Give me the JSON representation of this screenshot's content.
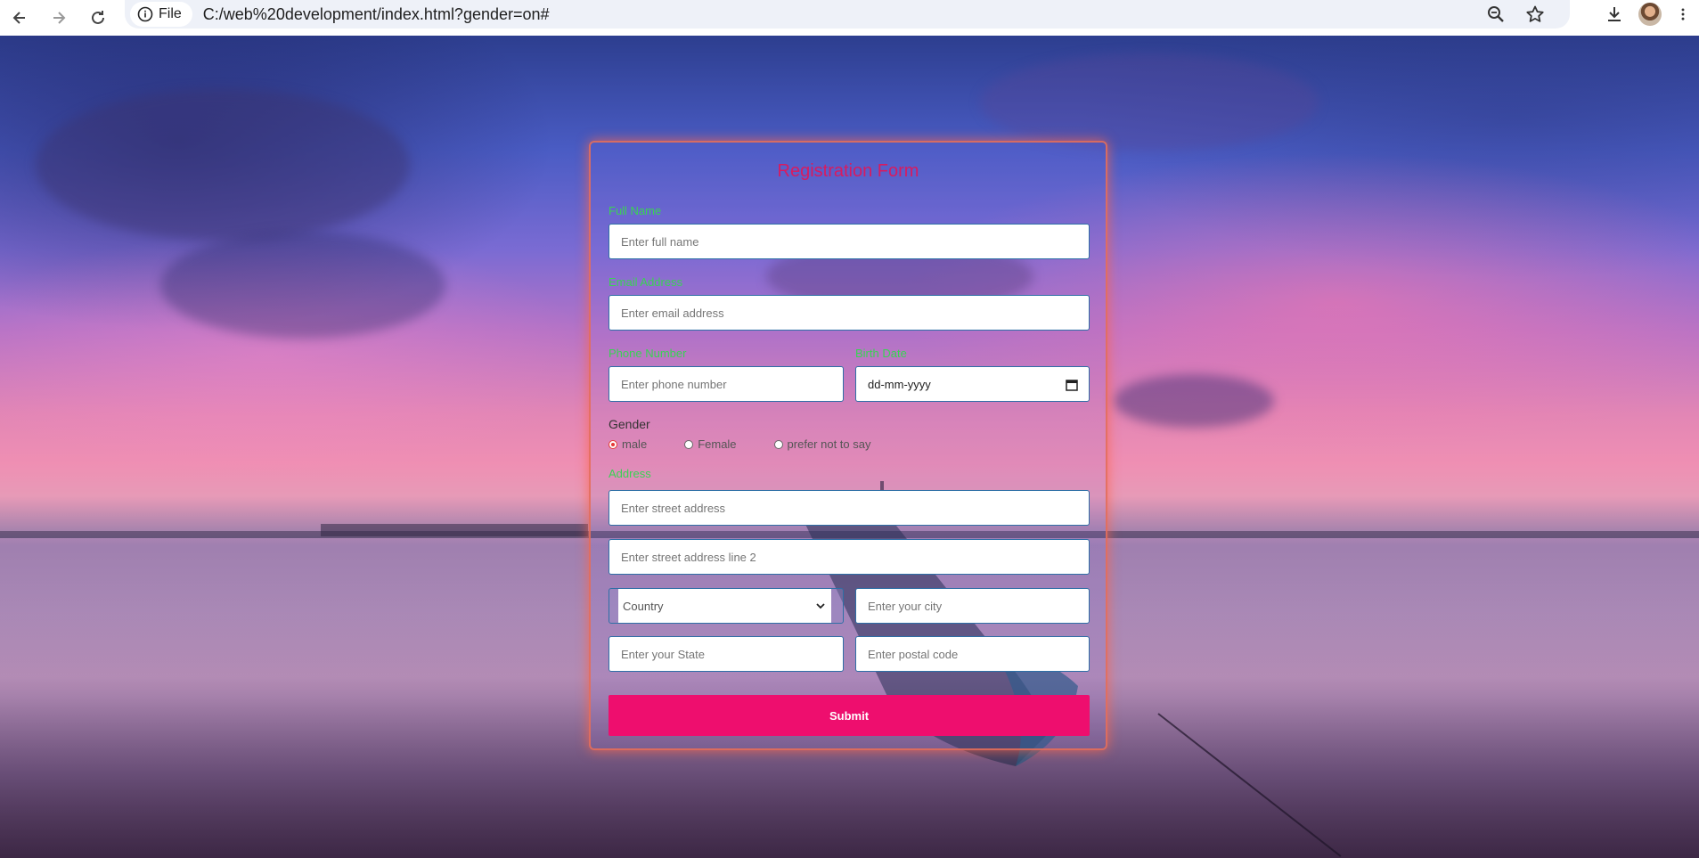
{
  "browser": {
    "site_chip_label": "File",
    "url": "C:/web%20development/index.html?gender=on#"
  },
  "form": {
    "title": "Registration Form",
    "full_name": {
      "label": "Full Name",
      "placeholder": "Enter full name"
    },
    "email": {
      "label": "Email Address",
      "placeholder": "Enter email address"
    },
    "phone": {
      "label": "Phone Number",
      "placeholder": "Enter phone number"
    },
    "birth_date": {
      "label": "Birth Date",
      "value": "dd-mm-yyyy"
    },
    "gender": {
      "label": "Gender",
      "options": [
        "male",
        "Female",
        "prefer not to say"
      ],
      "selected": "male"
    },
    "address": {
      "label": "Address",
      "street_placeholder": "Enter street address",
      "street2_placeholder": "Enter street address line 2",
      "country_value": "Country",
      "city_placeholder": "Enter your city",
      "state_placeholder": "Enter your State",
      "postal_placeholder": "Enter postal code"
    },
    "submit_label": "Submit"
  },
  "colors": {
    "title": "#d81b60",
    "field_label": "#39d353",
    "submit_bg": "#ee0e6e",
    "form_border": "#e66e5a"
  },
  "icons": [
    "back-arrow-icon",
    "forward-arrow-icon",
    "reload-icon",
    "info-icon",
    "zoom-icon",
    "bookmark-star-icon",
    "download-icon",
    "kebab-menu-icon",
    "calendar-icon",
    "chevron-down-icon"
  ]
}
